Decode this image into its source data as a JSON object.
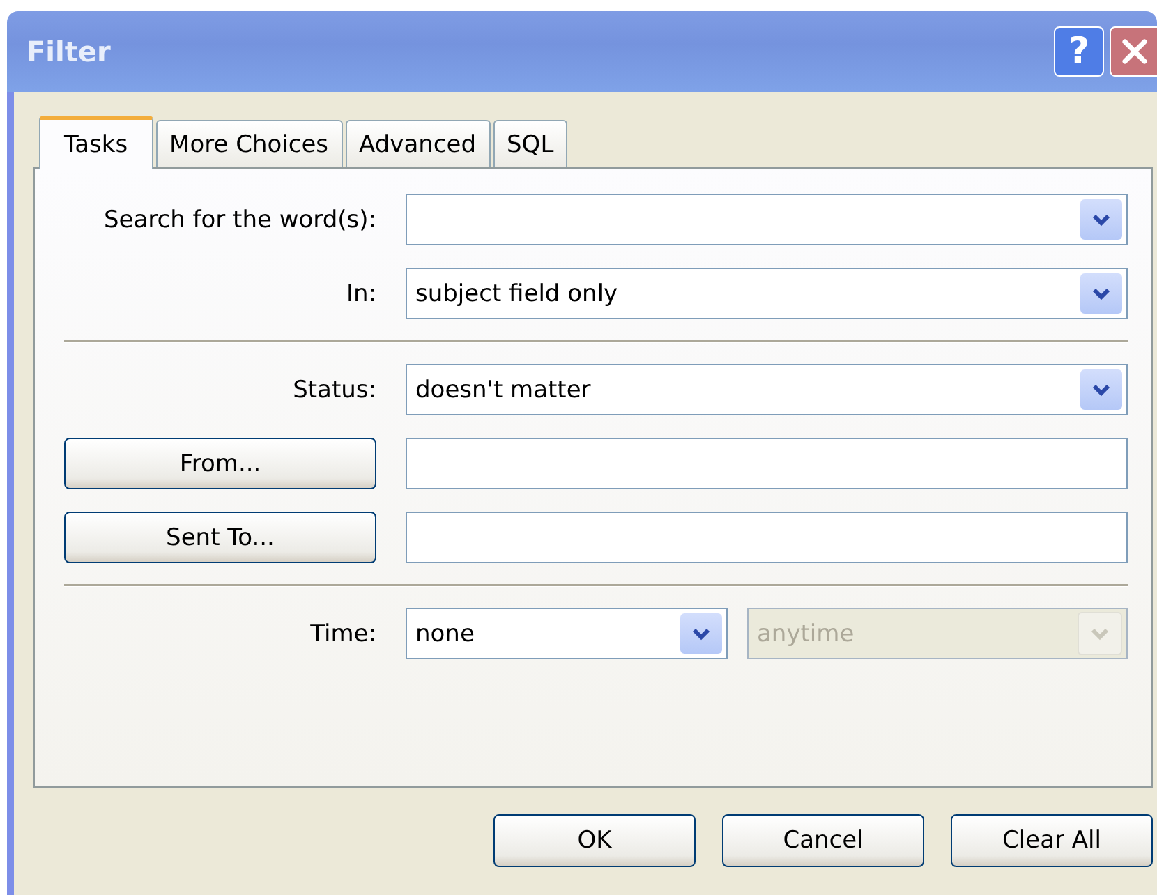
{
  "window": {
    "title": "Filter",
    "help_button": "?"
  },
  "tabs": [
    {
      "label": "Tasks",
      "selected": true
    },
    {
      "label": "More Choices",
      "selected": false
    },
    {
      "label": "Advanced",
      "selected": false
    },
    {
      "label": "SQL",
      "selected": false
    }
  ],
  "rows": [
    {
      "kind": "combo",
      "label": "Search for the word(s):",
      "value": ""
    },
    {
      "kind": "combo",
      "label": "In:",
      "value": "subject field only"
    },
    {
      "kind": "separator"
    },
    {
      "kind": "combo",
      "label": "Status:",
      "value": "doesn't matter"
    },
    {
      "kind": "button-field",
      "button": "From...",
      "value": ""
    },
    {
      "kind": "button-field",
      "button": "Sent To...",
      "value": ""
    },
    {
      "kind": "separator"
    },
    {
      "kind": "combo-pair",
      "label": "Time:",
      "value": "none",
      "second_value": "anytime",
      "second_disabled": true
    }
  ],
  "buttons": [
    "OK",
    "Cancel",
    "Clear All"
  ]
}
